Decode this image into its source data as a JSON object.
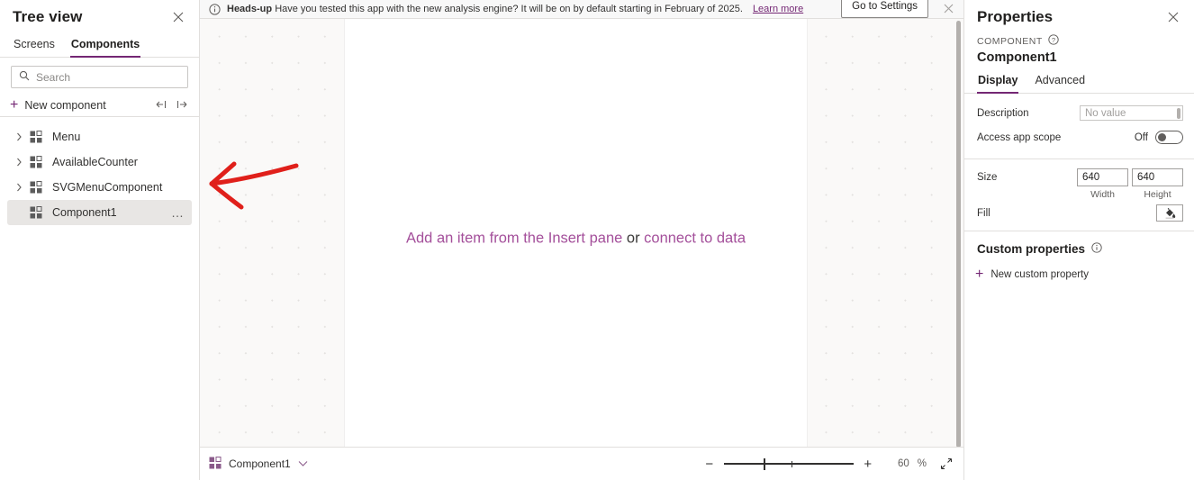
{
  "tree_view": {
    "title": "Tree view",
    "close_icon": "close-icon",
    "tabs": [
      {
        "label": "Screens",
        "active": false
      },
      {
        "label": "Components",
        "active": true
      }
    ],
    "search": {
      "placeholder": "Search",
      "value": "",
      "icon": "search-icon"
    },
    "new_component": {
      "label": "New component",
      "plus_icon": "plus-icon",
      "collapse_all_icon": "collapse-all-icon",
      "expand_all_icon": "expand-all-icon"
    },
    "items": [
      {
        "label": "Menu",
        "expandable": true,
        "selected": false,
        "icon": "component-icon"
      },
      {
        "label": "AvailableCounter",
        "expandable": true,
        "selected": false,
        "icon": "component-icon"
      },
      {
        "label": "SVGMenuComponent",
        "expandable": true,
        "selected": false,
        "icon": "component-icon"
      },
      {
        "label": "Component1",
        "expandable": false,
        "selected": true,
        "icon": "component-icon",
        "more": "…"
      }
    ]
  },
  "notification": {
    "info_icon": "info-icon",
    "title": "Heads-up",
    "message": "Have you tested this app with the new analysis engine? It will be on by default starting in February of 2025.",
    "link": "Learn more",
    "button": "Go to Settings",
    "close_icon": "close-icon"
  },
  "canvas": {
    "hint_link_1": "Add an item from the Insert pane",
    "hint_separator": "or",
    "hint_link_2": "connect to data",
    "link_color": "#a4509b"
  },
  "status_bar": {
    "component_icon": "component-icon",
    "component_label": "Component1",
    "dropdown_icon": "chevron-down-icon",
    "zoom_out_icon": "−",
    "zoom_in_icon": "+",
    "zoom_value": "60",
    "zoom_unit": "%",
    "fit_icon": "fit-to-screen-icon"
  },
  "properties": {
    "title": "Properties",
    "close_icon": "close-icon",
    "kicker": "COMPONENT",
    "kicker_help_icon": "help-icon",
    "component_name": "Component1",
    "tabs": [
      {
        "label": "Display",
        "active": true
      },
      {
        "label": "Advanced",
        "active": false
      }
    ],
    "description": {
      "label": "Description",
      "value": "",
      "placeholder": "No value"
    },
    "access_app_scope": {
      "label": "Access app scope",
      "state": "Off",
      "checked": false
    },
    "size": {
      "label": "Size",
      "width_value": "640",
      "height_value": "640",
      "width_sub": "Width",
      "height_sub": "Height"
    },
    "fill": {
      "label": "Fill",
      "swatch_icon": "paint-bucket-icon"
    },
    "custom_properties": {
      "title": "Custom properties",
      "info_icon": "info-icon",
      "new_label": "New custom property",
      "plus_icon": "plus-icon"
    }
  },
  "annotation": {
    "type": "red-arrow",
    "color": "#e0201b",
    "points_to": "Component1"
  }
}
